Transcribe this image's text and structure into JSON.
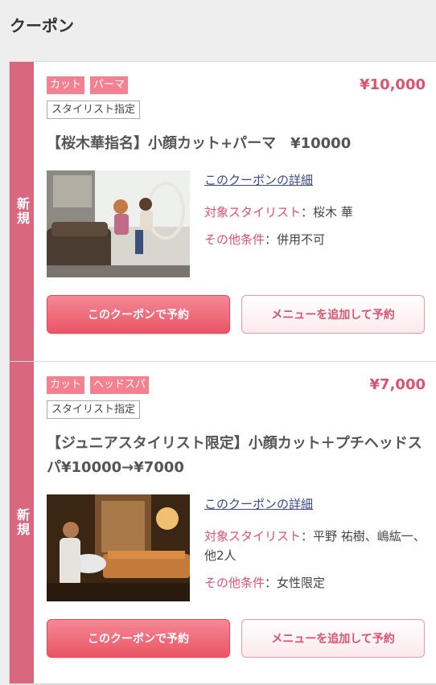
{
  "header": {
    "title": "クーポン"
  },
  "coupons": [
    {
      "new_label": "新規",
      "price": "¥10,000",
      "tags": [
        "カット",
        "パーマ"
      ],
      "stylist_tag": "スタイリスト指定",
      "title": "【桜木華指名】小顔カット+パーマ　¥10000",
      "detail_link": "このクーポンの詳細",
      "target_label": "対象スタイリスト",
      "target_value": "：桜木 華",
      "other_label": "その他条件",
      "other_value": "：併用不可",
      "reserve_label": "このクーポンで予約",
      "add_menu_label": "メニューを追加して予約"
    },
    {
      "new_label": "新規",
      "price": "¥7,000",
      "tags": [
        "カット",
        "ヘッドスパ"
      ],
      "stylist_tag": "スタイリスト指定",
      "title": "【ジュニアスタイリスト限定】小顔カット＋プチヘッドスパ¥10000→¥7000",
      "detail_link": "このクーポンの詳細",
      "target_label": "対象スタイリスト",
      "target_value": "：平野 祐樹、嶋紘一、他2人",
      "other_label": "その他条件",
      "other_value": "：女性限定",
      "reserve_label": "このクーポンで予約",
      "add_menu_label": "メニューを追加して予約"
    }
  ],
  "colors": {
    "accent": "#d9546f",
    "new_strip": "#d9687f",
    "tag_bg": "#f4818f",
    "reserve_button": "#ea5565"
  }
}
